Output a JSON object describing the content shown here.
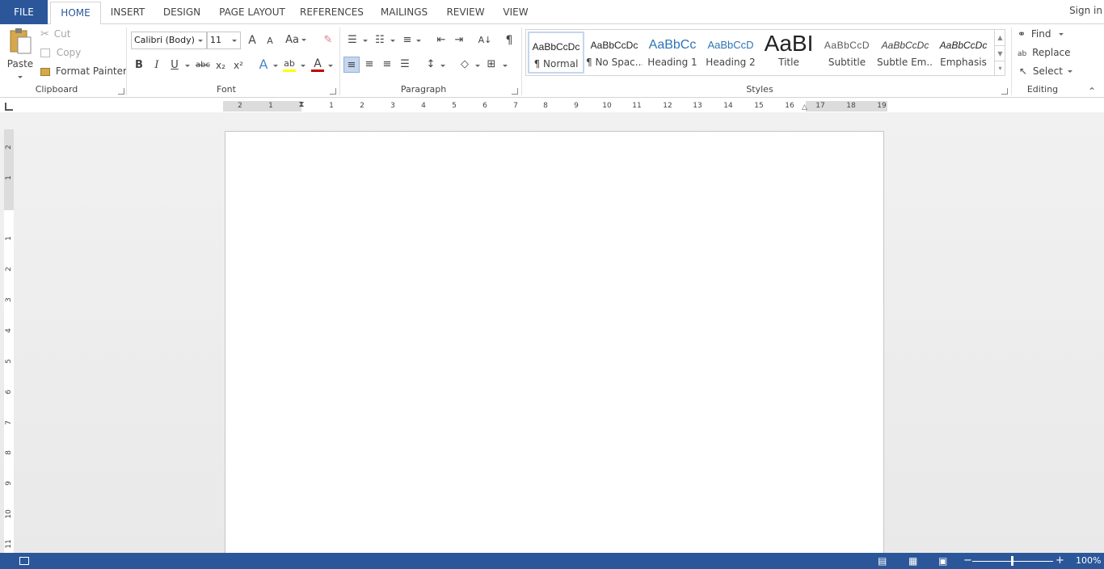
{
  "tabs": {
    "file": "FILE",
    "home": "HOME",
    "insert": "INSERT",
    "design": "DESIGN",
    "page_layout": "PAGE LAYOUT",
    "references": "REFERENCES",
    "mailings": "MAILINGS",
    "review": "REVIEW",
    "view": "VIEW"
  },
  "sign_in": "Sign in",
  "clipboard": {
    "group_label": "Clipboard",
    "paste": "Paste",
    "cut": "Cut",
    "copy": "Copy",
    "format_painter": "Format Painter"
  },
  "font": {
    "group_label": "Font",
    "font_name": "Calibri (Body)",
    "font_size": "11",
    "bold": "B",
    "italic": "I",
    "underline": "U",
    "strikethrough": "abc",
    "subscript": "x₂",
    "superscript": "x²",
    "change_case": "Aa",
    "grow": "A",
    "shrink": "A",
    "highlight_color": "#ffff00",
    "font_color": "#c00000"
  },
  "paragraph": {
    "group_label": "Paragraph"
  },
  "styles": {
    "group_label": "Styles",
    "items": [
      {
        "sample": "AaBbCcDc",
        "name": "¶ Normal"
      },
      {
        "sample": "AaBbCcDc",
        "name": "¶ No Spac..."
      },
      {
        "sample": "AaBbCc",
        "name": "Heading 1"
      },
      {
        "sample": "AaBbCcD",
        "name": "Heading 2"
      },
      {
        "sample": "AaBI",
        "name": "Title"
      },
      {
        "sample": "AaBbCcD",
        "name": "Subtitle"
      },
      {
        "sample": "AaBbCcDc",
        "name": "Subtle Em..."
      },
      {
        "sample": "AaBbCcDc",
        "name": "Emphasis"
      }
    ]
  },
  "editing": {
    "group_label": "Editing",
    "find": "Find",
    "replace": "Replace",
    "select": "Select"
  },
  "ruler": {
    "horizontal": [
      "2",
      "1",
      "1",
      "2",
      "3",
      "4",
      "5",
      "6",
      "7",
      "8",
      "9",
      "10",
      "11",
      "12",
      "13",
      "14",
      "15",
      "16",
      "17",
      "18",
      "19"
    ],
    "vertical": [
      "2",
      "1",
      "1",
      "2",
      "3",
      "4",
      "5",
      "6",
      "7",
      "8",
      "9",
      "10",
      "11"
    ]
  },
  "status": {
    "zoom": "100%"
  },
  "colors": {
    "accent": "#2b579a",
    "heading_blue": "#2e74b5"
  }
}
